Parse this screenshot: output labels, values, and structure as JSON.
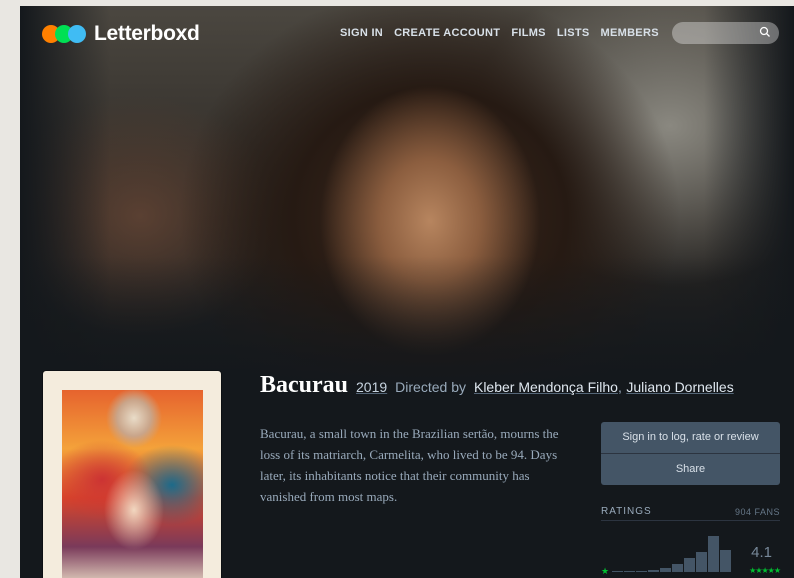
{
  "header": {
    "logo_text": "Letterboxd",
    "nav": [
      "SIGN IN",
      "CREATE ACCOUNT",
      "FILMS",
      "LISTS",
      "MEMBERS"
    ],
    "search_placeholder": ""
  },
  "film": {
    "title": "Bacurau",
    "year": "2019",
    "directed_by_label": "Directed by",
    "directors": [
      "Kleber Mendonça Filho",
      "Juliano Dornelles"
    ],
    "director_separator": ",",
    "synopsis": "Bacurau, a small town in the Brazilian sertão, mourns the loss of its matriarch, Carmelita, who lived to be 94. Days later, its inhabitants notice that their community has vanished from most maps."
  },
  "actions": {
    "sign_in_label": "Sign in to log, rate or review",
    "share_label": "Share"
  },
  "ratings": {
    "label": "RATINGS",
    "fans": "904 FANS",
    "average": "4.1",
    "low_star": "★",
    "high_stars": "★★★★★",
    "histogram": [
      0.02,
      0.03,
      0.04,
      0.06,
      0.12,
      0.22,
      0.38,
      0.56,
      1.0,
      0.62
    ]
  },
  "colors": {
    "background": "#14181c",
    "logo_orange": "#ff8000",
    "logo_green": "#00e054",
    "logo_blue": "#40bcf4",
    "button": "#445566",
    "star_green": "#00c030"
  }
}
